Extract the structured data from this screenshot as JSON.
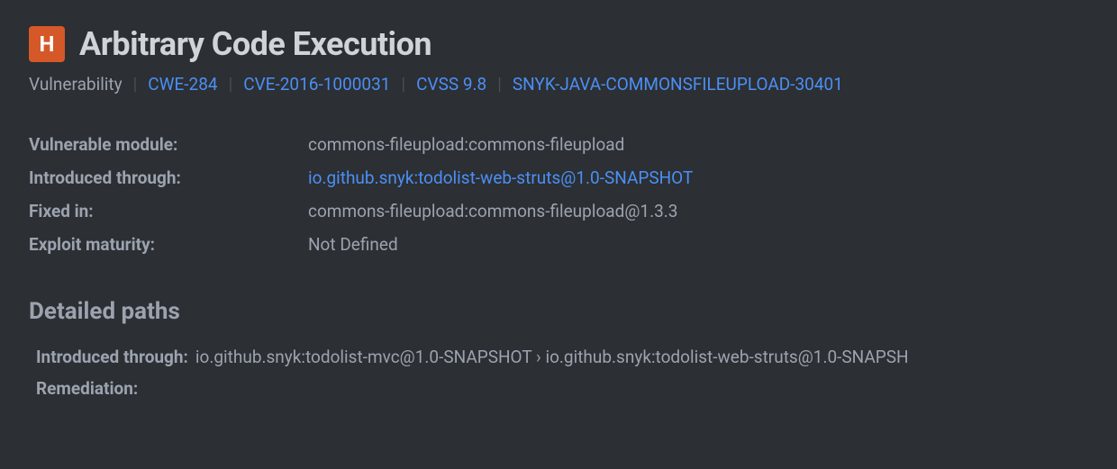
{
  "header": {
    "severity_letter": "H",
    "title": "Arbitrary Code Execution"
  },
  "meta": {
    "type_label": "Vulnerability",
    "cwe": "CWE-284",
    "cve": "CVE-2016-1000031",
    "cvss": "CVSS 9.8",
    "snyk_id": "SNYK-JAVA-COMMONSFILEUPLOAD-30401"
  },
  "details": {
    "vulnerable_module_label": "Vulnerable module:",
    "vulnerable_module_value": "commons-fileupload:commons-fileupload",
    "introduced_through_label": "Introduced through:",
    "introduced_through_value": "io.github.snyk:todolist-web-struts@1.0-SNAPSHOT",
    "fixed_in_label": "Fixed in:",
    "fixed_in_value": "commons-fileupload:commons-fileupload@1.3.3",
    "exploit_maturity_label": "Exploit maturity:",
    "exploit_maturity_value": "Not Defined"
  },
  "paths": {
    "section_title": "Detailed paths",
    "introduced_through_label": "Introduced through:",
    "introduced_through_value": "io.github.snyk:todolist-mvc@1.0-SNAPSHOT › io.github.snyk:todolist-web-struts@1.0-SNAPSH",
    "remediation_label": "Remediation:"
  }
}
